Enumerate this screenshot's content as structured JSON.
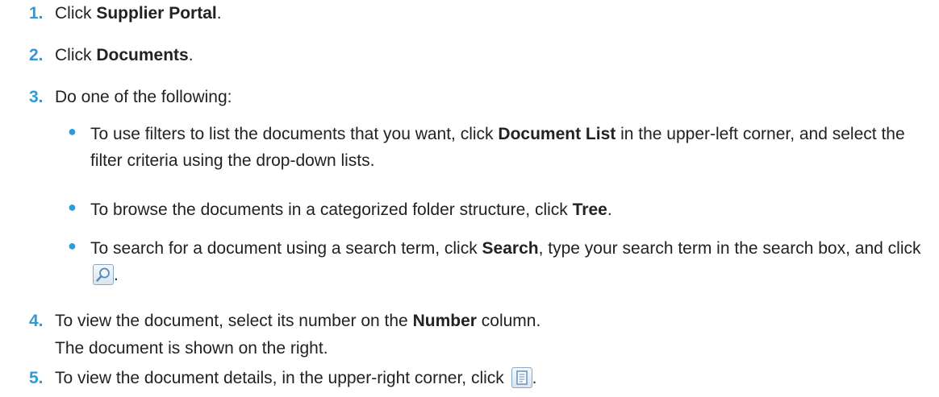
{
  "steps": [
    {
      "number": "1.",
      "pre": "Click ",
      "bold": "Supplier Portal",
      "post": "."
    },
    {
      "number": "2.",
      "pre": "Click ",
      "bold": "Documents",
      "post": "."
    },
    {
      "number": "3.",
      "text": "Do one of the following:"
    },
    {
      "number": "4.",
      "pre": "To view the document, select its number on the ",
      "bold": "Number",
      "post": " column.",
      "note": "The document is shown on the right."
    },
    {
      "number": "5.",
      "pre": "To view the document details, in the upper-right corner, click ",
      "post": "."
    }
  ],
  "options": [
    {
      "pre": "To use filters to list the documents that you want, click ",
      "bold": "Document List",
      "post": " in the upper-left corner, and select the filter criteria using the drop-down lists."
    },
    {
      "pre": "To browse the documents in a categorized folder structure, click ",
      "bold": "Tree",
      "post": "."
    },
    {
      "pre": "To search for a document using a search term, click ",
      "bold": "Search",
      "mid": ", type your search term in the search box, and click ",
      "post": "."
    }
  ],
  "icons": {
    "search": "magnifier-icon",
    "details": "document-details-icon"
  },
  "colors": {
    "number": "#2e9bd6",
    "bullet": "#2e9bd6",
    "text": "#222222"
  }
}
